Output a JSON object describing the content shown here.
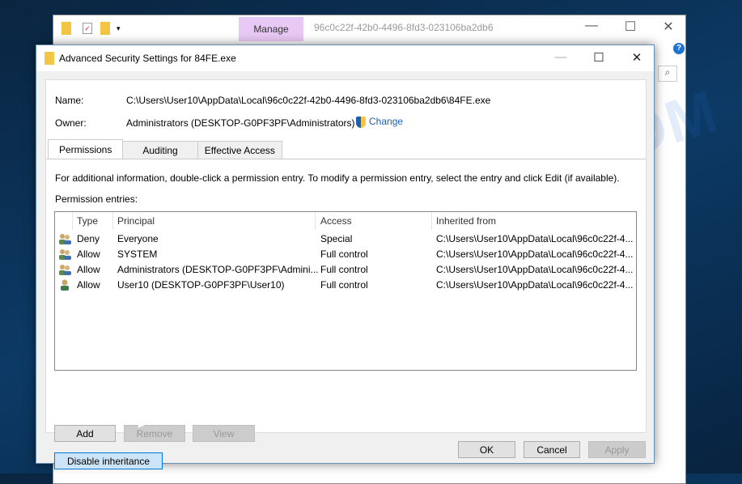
{
  "explorer": {
    "ribbon_tab": "Manage",
    "title": "96c0c22f-42b0-4496-8fd3-023106ba2db6",
    "minimize": "—",
    "maximize": "☐",
    "close": "✕",
    "help": "?"
  },
  "dialog": {
    "title": "Advanced Security Settings for 84FE.exe",
    "minimize": "—",
    "maximize": "☐",
    "close": "✕",
    "name_label": "Name:",
    "name_value": "C:\\Users\\User10\\AppData\\Local\\96c0c22f-42b0-4496-8fd3-023106ba2db6\\84FE.exe",
    "owner_label": "Owner:",
    "owner_value": "Administrators (DESKTOP-G0PF3PF\\Administrators)",
    "change_link": "Change",
    "tabs": [
      {
        "label": "Permissions",
        "active": true
      },
      {
        "label": "Auditing"
      },
      {
        "label": "Effective Access"
      }
    ],
    "info_text": "For additional information, double-click a permission entry. To modify a permission entry, select the entry and click Edit (if available).",
    "entries_label": "Permission entries:",
    "columns": [
      "Type",
      "Principal",
      "Access",
      "Inherited from"
    ],
    "rows": [
      {
        "icon": "group-icon",
        "type": "Deny",
        "principal": "Everyone",
        "access": "Special",
        "inherited": "C:\\Users\\User10\\AppData\\Local\\96c0c22f-4..."
      },
      {
        "icon": "group-icon",
        "type": "Allow",
        "principal": "SYSTEM",
        "access": "Full control",
        "inherited": "C:\\Users\\User10\\AppData\\Local\\96c0c22f-4..."
      },
      {
        "icon": "group-icon",
        "type": "Allow",
        "principal": "Administrators (DESKTOP-G0PF3PF\\Admini...",
        "access": "Full control",
        "inherited": "C:\\Users\\User10\\AppData\\Local\\96c0c22f-4..."
      },
      {
        "icon": "user-icon",
        "type": "Allow",
        "principal": "User10 (DESKTOP-G0PF3PF\\User10)",
        "access": "Full control",
        "inherited": "C:\\Users\\User10\\AppData\\Local\\96c0c22f-4..."
      }
    ],
    "buttons": {
      "add": "Add",
      "remove": "Remove",
      "view": "View",
      "disable_inheritance": "Disable inheritance",
      "ok": "OK",
      "cancel": "Cancel",
      "apply": "Apply"
    }
  },
  "watermark": "MYANTISPYWARE.COM"
}
